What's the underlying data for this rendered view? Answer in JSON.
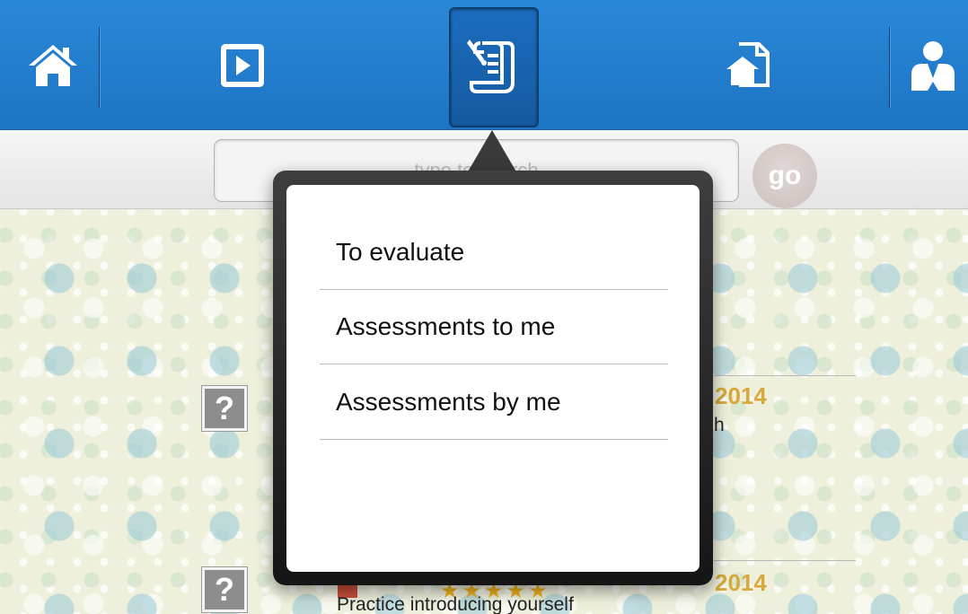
{
  "nav": {
    "items": [
      {
        "icon": "home-icon",
        "label": "Home"
      },
      {
        "icon": "play-icon",
        "label": "Play"
      },
      {
        "icon": "assessment-scroll-icon",
        "label": "Assessments"
      },
      {
        "icon": "document-home-icon",
        "label": "Documents"
      },
      {
        "icon": "user-icon",
        "label": "Profile"
      }
    ],
    "active": "assessment-scroll-icon",
    "bar_color": "#2a88d8"
  },
  "search": {
    "placeholder": "type to search",
    "go_label": "go"
  },
  "popover": {
    "items": [
      {
        "label": "To evaluate"
      },
      {
        "label": "Assessments to me"
      },
      {
        "label": "Assessments by me"
      }
    ]
  },
  "list": {
    "rows": [
      {
        "date": "2014",
        "text": "h"
      },
      {
        "date": "2014",
        "text": "Practice introducing yourself"
      }
    ],
    "date_color": "#d8a83a"
  }
}
